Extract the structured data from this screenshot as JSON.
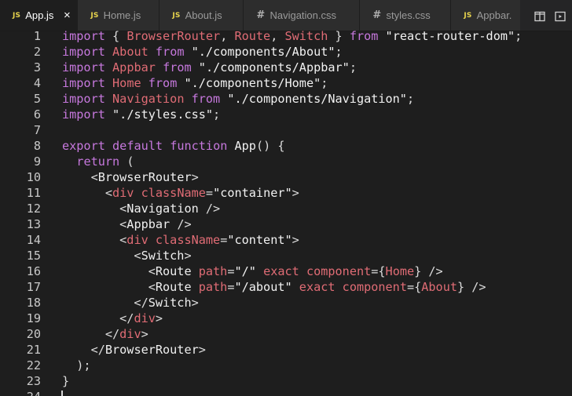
{
  "tabs": [
    {
      "icon": "JS",
      "label": "App.js",
      "active": true,
      "close": "×"
    },
    {
      "icon": "JS",
      "label": "Home.js"
    },
    {
      "icon": "JS",
      "label": "About.js"
    },
    {
      "icon": "#",
      "label": "Navigation.css"
    },
    {
      "icon": "#",
      "label": "styles.css"
    },
    {
      "icon": "JS",
      "label": "Appbar."
    }
  ],
  "lines": [
    {
      "n": "1",
      "t": [
        [
          "kw",
          "import"
        ],
        [
          "pn",
          " { "
        ],
        [
          "id",
          "BrowserRouter"
        ],
        [
          "pn",
          ", "
        ],
        [
          "id",
          "Route"
        ],
        [
          "pn",
          ", "
        ],
        [
          "id",
          "Switch"
        ],
        [
          "pn",
          " } "
        ],
        [
          "kw",
          "from"
        ],
        [
          "pn",
          " "
        ],
        [
          "str",
          "\"react-router-dom\""
        ],
        [
          "pn",
          ";"
        ]
      ]
    },
    {
      "n": "2",
      "t": [
        [
          "kw",
          "import"
        ],
        [
          "pn",
          " "
        ],
        [
          "id",
          "About"
        ],
        [
          "pn",
          " "
        ],
        [
          "kw",
          "from"
        ],
        [
          "pn",
          " "
        ],
        [
          "str",
          "\"./components/About\""
        ],
        [
          "pn",
          ";"
        ]
      ]
    },
    {
      "n": "3",
      "t": [
        [
          "kw",
          "import"
        ],
        [
          "pn",
          " "
        ],
        [
          "id",
          "Appbar"
        ],
        [
          "pn",
          " "
        ],
        [
          "kw",
          "from"
        ],
        [
          "pn",
          " "
        ],
        [
          "str",
          "\"./components/Appbar\""
        ],
        [
          "pn",
          ";"
        ]
      ]
    },
    {
      "n": "4",
      "t": [
        [
          "kw",
          "import"
        ],
        [
          "pn",
          " "
        ],
        [
          "id",
          "Home"
        ],
        [
          "pn",
          " "
        ],
        [
          "kw",
          "from"
        ],
        [
          "pn",
          " "
        ],
        [
          "str",
          "\"./components/Home\""
        ],
        [
          "pn",
          ";"
        ]
      ]
    },
    {
      "n": "5",
      "t": [
        [
          "kw",
          "import"
        ],
        [
          "pn",
          " "
        ],
        [
          "id",
          "Navigation"
        ],
        [
          "pn",
          " "
        ],
        [
          "kw",
          "from"
        ],
        [
          "pn",
          " "
        ],
        [
          "str",
          "\"./components/Navigation\""
        ],
        [
          "pn",
          ";"
        ]
      ]
    },
    {
      "n": "6",
      "t": [
        [
          "kw",
          "import"
        ],
        [
          "pn",
          " "
        ],
        [
          "str",
          "\"./styles.css\""
        ],
        [
          "pn",
          ";"
        ]
      ]
    },
    {
      "n": "7",
      "t": []
    },
    {
      "n": "8",
      "t": [
        [
          "kw",
          "export"
        ],
        [
          "pn",
          " "
        ],
        [
          "kw",
          "default"
        ],
        [
          "pn",
          " "
        ],
        [
          "kw",
          "function"
        ],
        [
          "pn",
          " "
        ],
        [
          "fn",
          "App"
        ],
        [
          "pn",
          "() {"
        ]
      ]
    },
    {
      "n": "9",
      "t": [
        [
          "pn",
          "  "
        ],
        [
          "kw",
          "return"
        ],
        [
          "pn",
          " ("
        ]
      ]
    },
    {
      "n": "10",
      "t": [
        [
          "pn",
          "    <"
        ],
        [
          "tag",
          "BrowserRouter"
        ],
        [
          "pn",
          ">"
        ]
      ]
    },
    {
      "n": "11",
      "t": [
        [
          "pn",
          "      <"
        ],
        [
          "id",
          "div"
        ],
        [
          "pn",
          " "
        ],
        [
          "id",
          "className"
        ],
        [
          "pn",
          "="
        ],
        [
          "str",
          "\"container\""
        ],
        [
          "pn",
          ">"
        ]
      ]
    },
    {
      "n": "12",
      "t": [
        [
          "pn",
          "        <"
        ],
        [
          "tag",
          "Navigation"
        ],
        [
          "pn",
          " />"
        ]
      ]
    },
    {
      "n": "13",
      "t": [
        [
          "pn",
          "        <"
        ],
        [
          "tag",
          "Appbar"
        ],
        [
          "pn",
          " />"
        ]
      ]
    },
    {
      "n": "14",
      "t": [
        [
          "pn",
          "        <"
        ],
        [
          "id",
          "div"
        ],
        [
          "pn",
          " "
        ],
        [
          "id",
          "className"
        ],
        [
          "pn",
          "="
        ],
        [
          "str",
          "\"content\""
        ],
        [
          "pn",
          ">"
        ]
      ]
    },
    {
      "n": "15",
      "t": [
        [
          "pn",
          "          <"
        ],
        [
          "tag",
          "Switch"
        ],
        [
          "pn",
          ">"
        ]
      ]
    },
    {
      "n": "16",
      "t": [
        [
          "pn",
          "            <"
        ],
        [
          "tag",
          "Route"
        ],
        [
          "pn",
          " "
        ],
        [
          "id",
          "path"
        ],
        [
          "pn",
          "="
        ],
        [
          "str",
          "\"/\""
        ],
        [
          "pn",
          " "
        ],
        [
          "id",
          "exact"
        ],
        [
          "pn",
          " "
        ],
        [
          "id",
          "component"
        ],
        [
          "pn",
          "={"
        ],
        [
          "id",
          "Home"
        ],
        [
          "pn",
          "} />"
        ]
      ]
    },
    {
      "n": "17",
      "t": [
        [
          "pn",
          "            <"
        ],
        [
          "tag",
          "Route"
        ],
        [
          "pn",
          " "
        ],
        [
          "id",
          "path"
        ],
        [
          "pn",
          "="
        ],
        [
          "str",
          "\"/about\""
        ],
        [
          "pn",
          " "
        ],
        [
          "id",
          "exact"
        ],
        [
          "pn",
          " "
        ],
        [
          "id",
          "component"
        ],
        [
          "pn",
          "={"
        ],
        [
          "id",
          "About"
        ],
        [
          "pn",
          "} />"
        ]
      ]
    },
    {
      "n": "18",
      "t": [
        [
          "pn",
          "          </"
        ],
        [
          "tag",
          "Switch"
        ],
        [
          "pn",
          ">"
        ]
      ]
    },
    {
      "n": "19",
      "t": [
        [
          "pn",
          "        </"
        ],
        [
          "id",
          "div"
        ],
        [
          "pn",
          ">"
        ]
      ]
    },
    {
      "n": "20",
      "t": [
        [
          "pn",
          "      </"
        ],
        [
          "id",
          "div"
        ],
        [
          "pn",
          ">"
        ]
      ]
    },
    {
      "n": "21",
      "t": [
        [
          "pn",
          "    </"
        ],
        [
          "tag",
          "BrowserRouter"
        ],
        [
          "pn",
          ">"
        ]
      ]
    },
    {
      "n": "22",
      "t": [
        [
          "pn",
          "  );"
        ]
      ]
    },
    {
      "n": "23",
      "t": [
        [
          "pn",
          "}"
        ]
      ]
    },
    {
      "n": "24",
      "t": []
    }
  ],
  "colors": {
    "keyword": "#c678dd",
    "identifier": "#e06c75",
    "js_icon": "#e8d44d",
    "background": "#1e1e1e"
  },
  "actions": [
    "split-editor-icon",
    "open-preview-icon"
  ]
}
